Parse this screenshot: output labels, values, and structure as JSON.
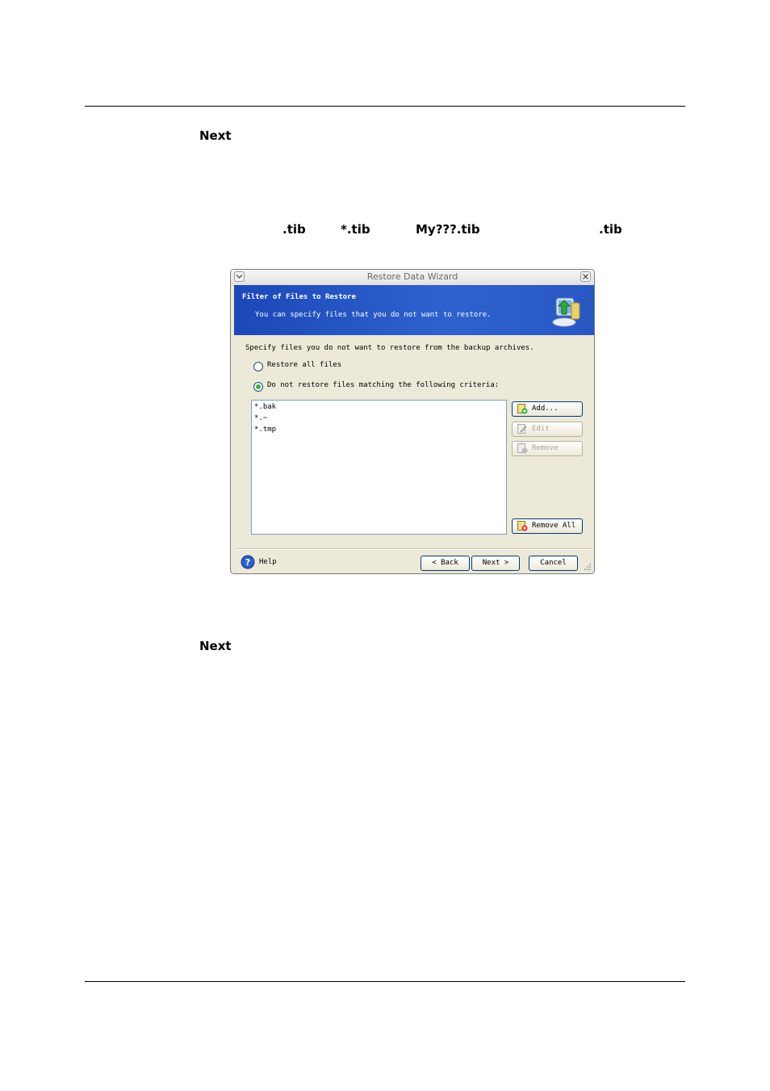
{
  "doc": {
    "next_1": "Next",
    "tib_1": ".tib",
    "tib_star": "*.tib",
    "tib_my": "My???.tib",
    "tib_2": ".tib",
    "next_2": "Next"
  },
  "window": {
    "title": "Restore Data Wizard",
    "banner_heading": "Filter of Files to Restore",
    "banner_subtitle": "You can specify files that you do not want to restore.",
    "instruction": "Specify files you do not want to restore from the backup archives.",
    "radio_all": "Restore all files",
    "radio_criteria": "Do not restore files matching the following criteria:",
    "selected_option": "criteria",
    "criteria": [
      "*.bak",
      "*.~",
      "*.tmp"
    ],
    "buttons": {
      "add": "Add...",
      "edit": "Edit",
      "remove": "Remove",
      "remove_all": "Remove All",
      "help": "Help",
      "back": "< Back",
      "next": "Next >",
      "cancel": "Cancel"
    }
  },
  "colors": {
    "banner": "#2f62cf",
    "accent_green": "#3cb33c",
    "button_border": "#003c74"
  }
}
